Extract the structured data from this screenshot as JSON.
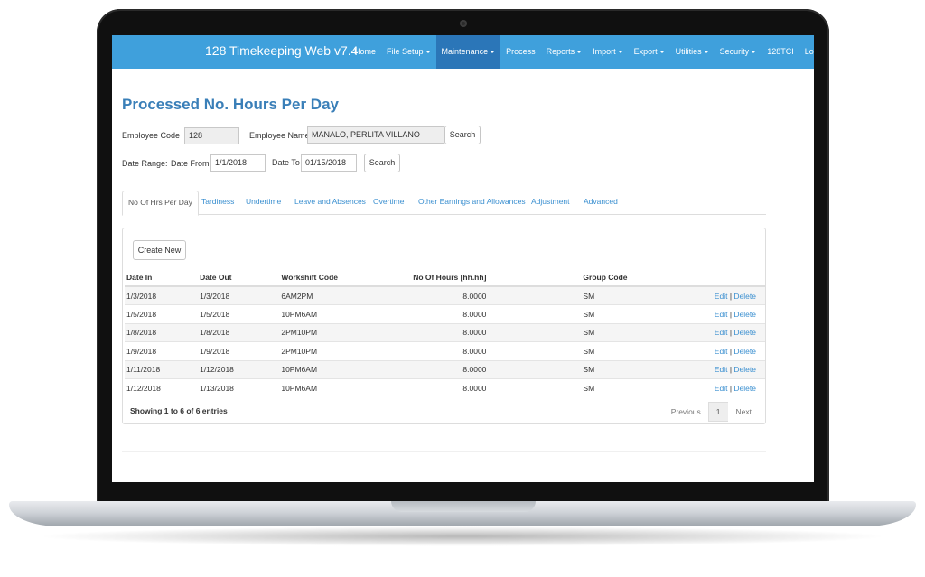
{
  "app": {
    "title": "128 Timekeeping Web v7.4"
  },
  "nav": {
    "items": [
      {
        "label": "Home",
        "dropdown": false,
        "active": false
      },
      {
        "label": "File Setup",
        "dropdown": true,
        "active": false
      },
      {
        "label": "Maintenance",
        "dropdown": true,
        "active": true
      },
      {
        "label": "Process",
        "dropdown": false,
        "active": false
      },
      {
        "label": "Reports",
        "dropdown": true,
        "active": false
      },
      {
        "label": "Import",
        "dropdown": true,
        "active": false
      },
      {
        "label": "Export",
        "dropdown": true,
        "active": false
      },
      {
        "label": "Utilities",
        "dropdown": true,
        "active": false
      },
      {
        "label": "Security",
        "dropdown": true,
        "active": false
      },
      {
        "label": "128TCI",
        "dropdown": false,
        "active": false
      },
      {
        "label": "Log off",
        "dropdown": false,
        "active": false
      }
    ]
  },
  "page": {
    "title": "Processed No. Hours Per Day"
  },
  "filters": {
    "employee_code_label": "Employee Code",
    "employee_code_value": "128",
    "employee_name_label": "Employee Name",
    "employee_name_value": "MANALO, PERLITA VILLANO",
    "search_label": "Search",
    "date_range_label": "Date Range:",
    "date_from_label": "Date From",
    "date_from_value": "1/1/2018",
    "date_to_label": "Date To",
    "date_to_value": "01/15/2018",
    "search2_label": "Search"
  },
  "tabs": [
    {
      "label": "No Of Hrs Per Day",
      "active": true
    },
    {
      "label": "Tardiness",
      "active": false
    },
    {
      "label": "Undertime",
      "active": false
    },
    {
      "label": "Leave and Absences",
      "active": false
    },
    {
      "label": "Overtime",
      "active": false
    },
    {
      "label": "Other Earnings and Allowances",
      "active": false
    },
    {
      "label": "Adjustment",
      "active": false
    },
    {
      "label": "Advanced",
      "active": false
    }
  ],
  "panel": {
    "create_new_label": "Create New"
  },
  "table": {
    "headers": {
      "date_in": "Date In",
      "date_out": "Date Out",
      "workshift": "Workshift Code",
      "hours": "No Of Hours [hh.hh]",
      "group": "Group Code"
    },
    "rows": [
      {
        "date_in": "1/3/2018",
        "date_out": "1/3/2018",
        "workshift": "6AM2PM",
        "hours": "8.0000",
        "group": "SM"
      },
      {
        "date_in": "1/5/2018",
        "date_out": "1/5/2018",
        "workshift": "10PM6AM",
        "hours": "8.0000",
        "group": "SM"
      },
      {
        "date_in": "1/8/2018",
        "date_out": "1/8/2018",
        "workshift": "2PM10PM",
        "hours": "8.0000",
        "group": "SM"
      },
      {
        "date_in": "1/9/2018",
        "date_out": "1/9/2018",
        "workshift": "2PM10PM",
        "hours": "8.0000",
        "group": "SM"
      },
      {
        "date_in": "1/11/2018",
        "date_out": "1/12/2018",
        "workshift": "10PM6AM",
        "hours": "8.0000",
        "group": "SM"
      },
      {
        "date_in": "1/12/2018",
        "date_out": "1/13/2018",
        "workshift": "10PM6AM",
        "hours": "8.0000",
        "group": "SM"
      }
    ],
    "edit_label": "Edit",
    "separator": "|",
    "delete_label": "Delete"
  },
  "footer": {
    "summary": "Showing 1 to 6 of 6 entries",
    "previous_label": "Previous",
    "current_page": "1",
    "next_label": "Next"
  },
  "colors": {
    "navbar": "#3fa0dc",
    "navbar_active": "#2b76b8",
    "title": "#3a7fb8",
    "link": "#3a8fd0"
  }
}
